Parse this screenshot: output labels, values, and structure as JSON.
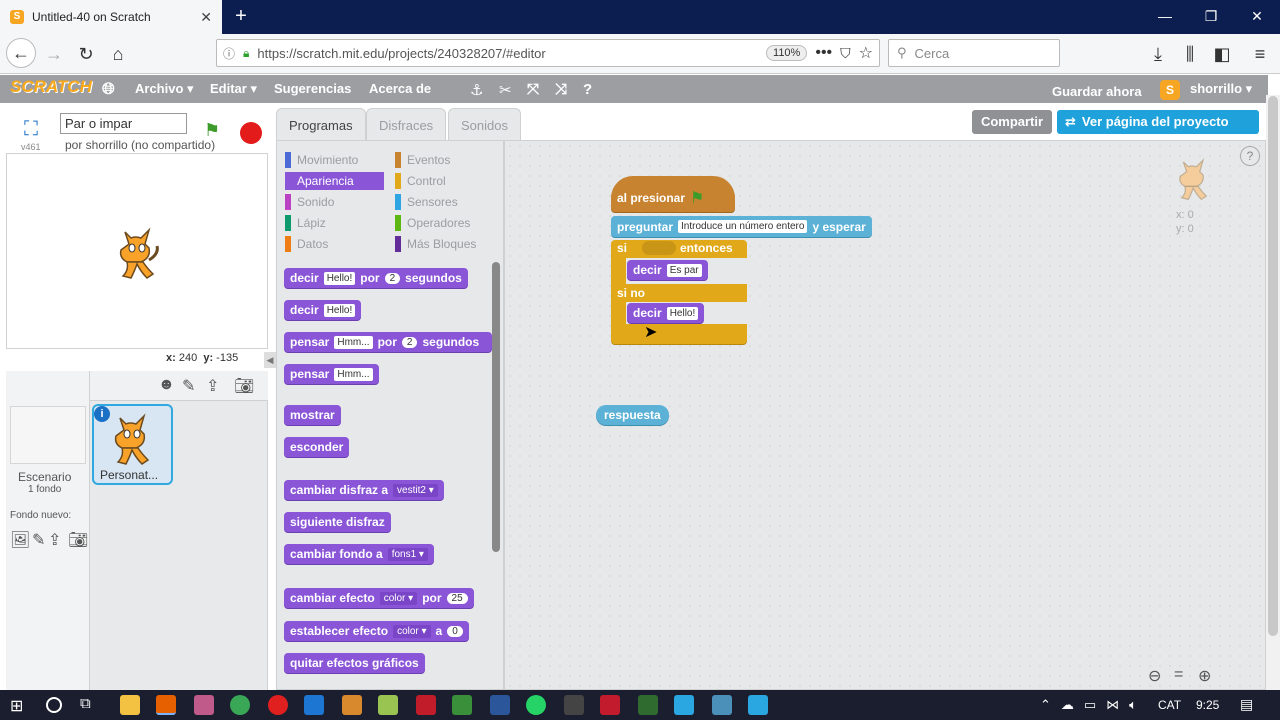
{
  "browser": {
    "tab_title": "Untitled-40 on Scratch",
    "tab_favicon": "S",
    "url": "https://scratch.mit.edu/projects/240328207/#editor",
    "zoom": "110%",
    "search_placeholder": "Cerca"
  },
  "menubar": {
    "logo": "SCRATCH",
    "file": "Archivo ▾",
    "edit": "Editar ▾",
    "tips": "Sugerencias",
    "about": "Acerca de",
    "save_now": "Guardar ahora",
    "user": "shorrillo ▾"
  },
  "stage": {
    "version": "v461",
    "project_title": "Par o impar",
    "byline": "por shorrillo (no compartido)",
    "x_label": "x:",
    "x_value": "240",
    "y_label": "y:",
    "y_value": "-135"
  },
  "sprites_pane": {
    "scene_label": "Escenario",
    "scene_count": "1 fondo",
    "new_bg_label": "Fondo nuevo:",
    "sprite_name": "Personat..."
  },
  "header_buttons": {
    "share": "Compartir",
    "see_project": "Ver página del proyecto"
  },
  "tabs": [
    "Programas",
    "Disfraces",
    "Sonidos"
  ],
  "categories_left": [
    {
      "label": "Movimiento",
      "color": "#4a6cd4"
    },
    {
      "label": "Apariencia",
      "color": "#8a55d7"
    },
    {
      "label": "Sonido",
      "color": "#bb42c3"
    },
    {
      "label": "Lápiz",
      "color": "#0e9a6c"
    },
    {
      "label": "Datos",
      "color": "#ee7d16"
    }
  ],
  "categories_right": [
    {
      "label": "Eventos",
      "color": "#c88330"
    },
    {
      "label": "Control",
      "color": "#e1a91a"
    },
    {
      "label": "Sensores",
      "color": "#2ca5e2"
    },
    {
      "label": "Operadores",
      "color": "#5cb712"
    },
    {
      "label": "Más Bloques",
      "color": "#632d99"
    }
  ],
  "palette_blocks": {
    "say_secs": {
      "a": "decir",
      "slot": "Hello!",
      "b": "por",
      "num": "2",
      "c": "segundos"
    },
    "say": {
      "a": "decir",
      "slot": "Hello!"
    },
    "think_secs": {
      "a": "pensar",
      "slot": "Hmm...",
      "b": "por",
      "num": "2",
      "c": "segundos"
    },
    "think": {
      "a": "pensar",
      "slot": "Hmm..."
    },
    "show": "mostrar",
    "hide": "esconder",
    "switch_costume": {
      "a": "cambiar disfraz a",
      "dd": "vestit2 ▾"
    },
    "next_costume": "siguiente disfraz",
    "switch_bg": {
      "a": "cambiar fondo a",
      "dd": "fons1 ▾"
    },
    "change_effect": {
      "a": "cambiar efecto",
      "dd": "color ▾",
      "b": "por",
      "num": "25"
    },
    "set_effect": {
      "a": "establecer efecto",
      "dd": "color ▾",
      "b": "a",
      "num": "0"
    },
    "clear_effects": "quitar efectos gráficos"
  },
  "script": {
    "hat": "al presionar",
    "ask": {
      "a": "preguntar",
      "slot": "Introduce un número entero",
      "b": "y esperar"
    },
    "if": "si",
    "then": "entonces",
    "say1": {
      "a": "decir",
      "slot": "Es par"
    },
    "else": "si no",
    "say2": {
      "a": "decir",
      "slot": "Hello!"
    },
    "answer": "respuesta"
  },
  "sprite_info": {
    "x": "x: 0",
    "y": "y: 0"
  },
  "taskbar": {
    "lang": "CAT",
    "time": "9:25"
  }
}
